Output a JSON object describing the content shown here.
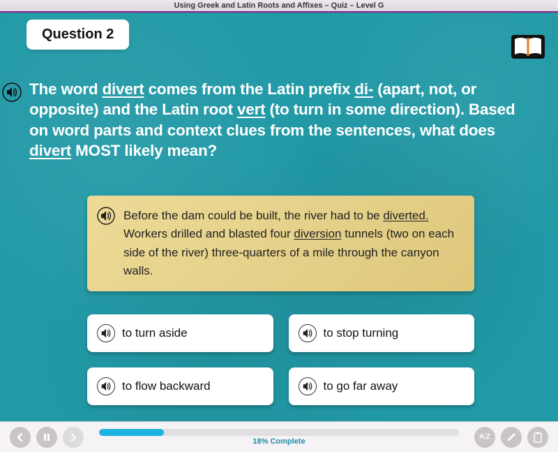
{
  "header": {
    "title": "Using Greek and Latin Roots and Affixes – Quiz – Level G"
  },
  "question": {
    "label": "Question 2",
    "text_parts": [
      "The word ",
      {
        "u": "divert"
      },
      " comes from the Latin prefix ",
      {
        "u": "di-"
      },
      " (apart, not, or opposite) and the Latin root ",
      {
        "u": "vert"
      },
      " (to turn in some direction). Based on word parts and context clues from the sentences, what does ",
      {
        "u": "divert"
      },
      " MOST likely mean?"
    ]
  },
  "passage": {
    "text_parts": [
      "Before the dam could be built, the river had to be ",
      {
        "u": "diverted."
      },
      " Workers drilled and blasted four ",
      {
        "u": "diversion"
      },
      " tunnels (two on each side of the river) three-quarters of a mile through the canyon walls."
    ]
  },
  "answers": [
    {
      "text": "to turn aside"
    },
    {
      "text": "to stop turning"
    },
    {
      "text": "to flow backward"
    },
    {
      "text": "to go far away"
    }
  ],
  "progress": {
    "percent": 18,
    "label": "18% Complete"
  },
  "icons": {
    "book": "book-icon",
    "audio": "audio-icon",
    "back": "←",
    "pause": "❚❚",
    "forward": "→",
    "glossary": "A|Z",
    "pencil": "✎",
    "clipboard": "📋"
  }
}
